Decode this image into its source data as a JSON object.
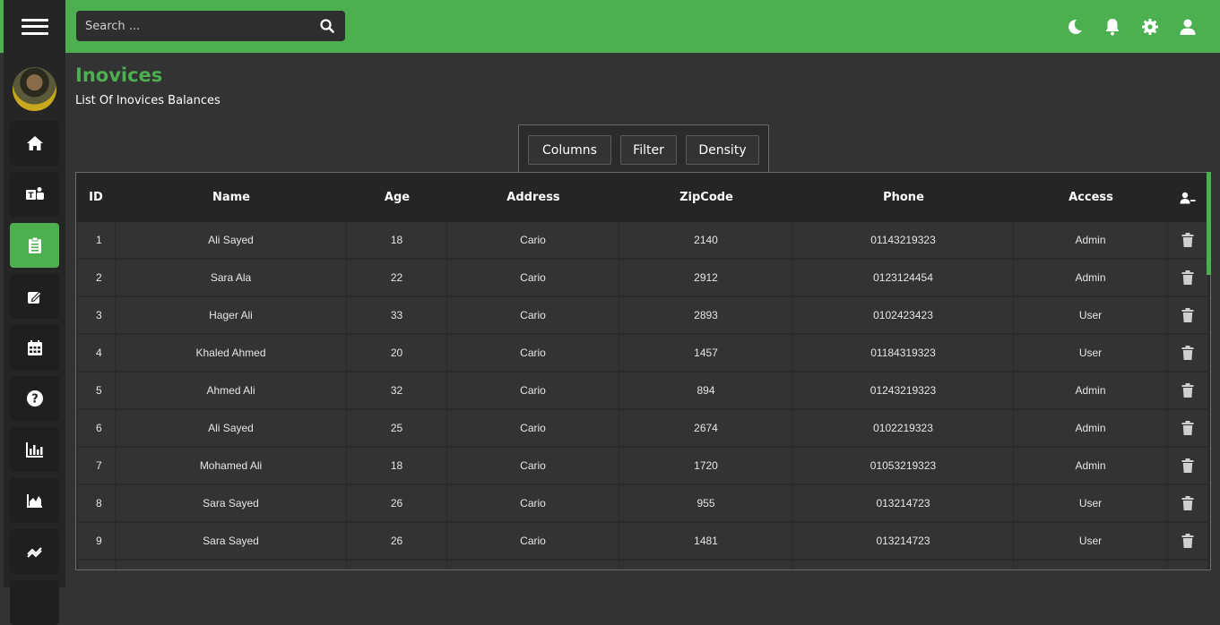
{
  "search": {
    "placeholder": "Search ..."
  },
  "topbar": {
    "icons": [
      "moon-icon",
      "bell-icon",
      "gear-icon",
      "user-icon"
    ]
  },
  "sidebar": {
    "items": [
      {
        "icon": "home-icon"
      },
      {
        "icon": "teams-icon"
      },
      {
        "icon": "clipboard-icon",
        "active": true
      },
      {
        "icon": "edit-icon"
      },
      {
        "icon": "calendar-icon"
      },
      {
        "icon": "help-icon"
      },
      {
        "icon": "bar-chart-icon"
      },
      {
        "icon": "area-chart-icon"
      },
      {
        "icon": "line-chart-icon"
      }
    ]
  },
  "page": {
    "title": "Inovices",
    "subtitle": "List Of Inovices Balances"
  },
  "toolbar": {
    "columns": "Columns",
    "filter": "Filter",
    "density": "Density"
  },
  "table": {
    "headers": {
      "id": "ID",
      "name": "Name",
      "age": "Age",
      "address": "Address",
      "zipcode": "ZipCode",
      "phone": "Phone",
      "access": "Access"
    },
    "rows": [
      {
        "id": "1",
        "name": "Ali Sayed",
        "age": "18",
        "address": "Cario",
        "zipcode": "2140",
        "phone": "01143219323",
        "access": "Admin"
      },
      {
        "id": "2",
        "name": "Sara Ala",
        "age": "22",
        "address": "Cario",
        "zipcode": "2912",
        "phone": "0123124454",
        "access": "Admin"
      },
      {
        "id": "3",
        "name": "Hager Ali",
        "age": "33",
        "address": "Cario",
        "zipcode": "2893",
        "phone": "0102423423",
        "access": "User"
      },
      {
        "id": "4",
        "name": "Khaled Ahmed",
        "age": "20",
        "address": "Cario",
        "zipcode": "1457",
        "phone": "01184319323",
        "access": "User"
      },
      {
        "id": "5",
        "name": "Ahmed Ali",
        "age": "32",
        "address": "Cario",
        "zipcode": "894",
        "phone": "01243219323",
        "access": "Admin"
      },
      {
        "id": "6",
        "name": "Ali Sayed",
        "age": "25",
        "address": "Cario",
        "zipcode": "2674",
        "phone": "0102219323",
        "access": "Admin"
      },
      {
        "id": "7",
        "name": "Mohamed Ali",
        "age": "18",
        "address": "Cario",
        "zipcode": "1720",
        "phone": "01053219323",
        "access": "Admin"
      },
      {
        "id": "8",
        "name": "Sara Sayed",
        "age": "26",
        "address": "Cario",
        "zipcode": "955",
        "phone": "013214723",
        "access": "User"
      },
      {
        "id": "9",
        "name": "Sara Sayed",
        "age": "26",
        "address": "Cario",
        "zipcode": "1481",
        "phone": "013214723",
        "access": "User"
      }
    ]
  },
  "colors": {
    "accent": "#4caf50",
    "background": "#333333",
    "panel": "#252525"
  }
}
